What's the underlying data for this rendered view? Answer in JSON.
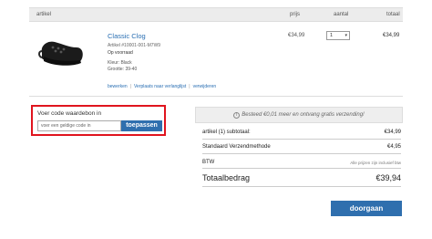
{
  "table_header": {
    "artikel": "artikel",
    "prijs": "prijs",
    "aantal": "aantal",
    "totaal": "totaal"
  },
  "product": {
    "name": "Classic Clog",
    "article_no": "Artikel #10001-001-M7W9",
    "stock": "Op voorraad",
    "color": "Kleur:   Black",
    "size": "Grootte:   39-40",
    "price": "€34,99",
    "quantity": "1",
    "total": "€34,99",
    "actions": [
      "bewerken",
      "Verplaats naar verlanglijst",
      "verwijderen"
    ]
  },
  "coupon": {
    "label": "Voer code waardebon in",
    "placeholder": "voer een geldige code in",
    "button": "toepassen"
  },
  "shipping_banner": "Besteed €0,01 meer en ontvang gratis verzending!",
  "summary": {
    "subtotal_label": "artikel (1) subtotaal:",
    "subtotal_value": "€34,99",
    "shipping_label": "Standaard Verzendmethode",
    "shipping_value": "€4,95",
    "vat_label": "BTW",
    "vat_note": "Alle prijzen zijn inclusief btw",
    "total_label": "Totaalbedrag",
    "total_value": "€39,94"
  },
  "checkout_button": "doorgaan"
}
